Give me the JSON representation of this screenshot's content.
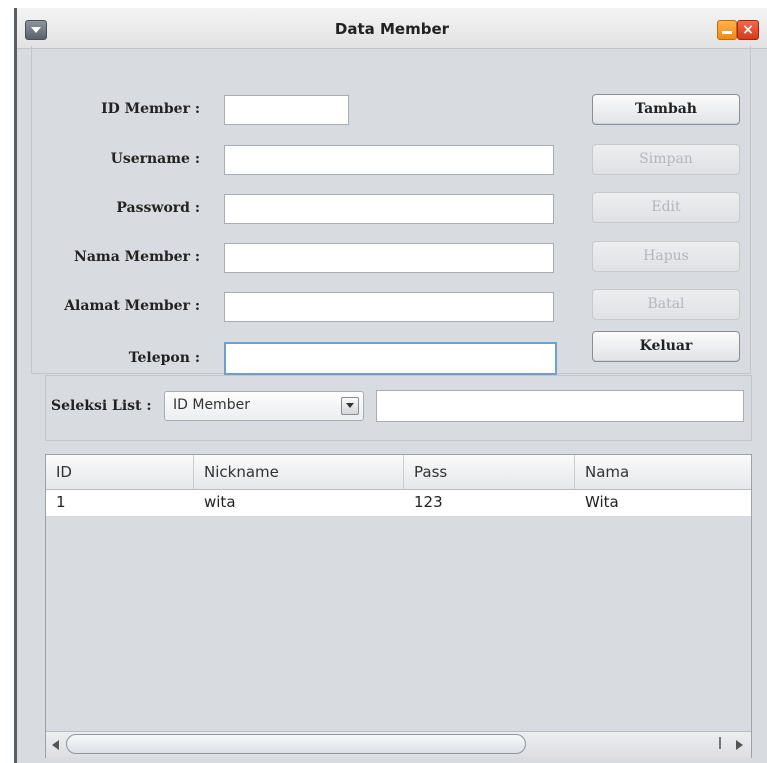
{
  "window": {
    "title": "Data Member"
  },
  "form": {
    "fields": [
      {
        "label": "ID Member :",
        "value": ""
      },
      {
        "label": "Username :",
        "value": ""
      },
      {
        "label": "Password :",
        "value": ""
      },
      {
        "label": "Nama Member :",
        "value": ""
      },
      {
        "label": "Alamat Member :",
        "value": ""
      },
      {
        "label": "Telepon :",
        "value": ""
      }
    ],
    "buttons": {
      "tambah": "Tambah",
      "simpan": "Simpan",
      "edit": "Edit",
      "hapus": "Hapus",
      "batal": "Batal",
      "keluar": "Keluar"
    }
  },
  "selection": {
    "label": "Seleksi List :",
    "selected": "ID Member",
    "search_value": ""
  },
  "table": {
    "columns": [
      "ID",
      "Nickname",
      "Pass",
      "Nama"
    ],
    "rows": [
      [
        "1",
        "wita",
        "123",
        "Wita"
      ]
    ]
  },
  "colors": {
    "window_bg": "#d8dbe0",
    "minimize": "#f08a16",
    "close": "#d8391c"
  }
}
